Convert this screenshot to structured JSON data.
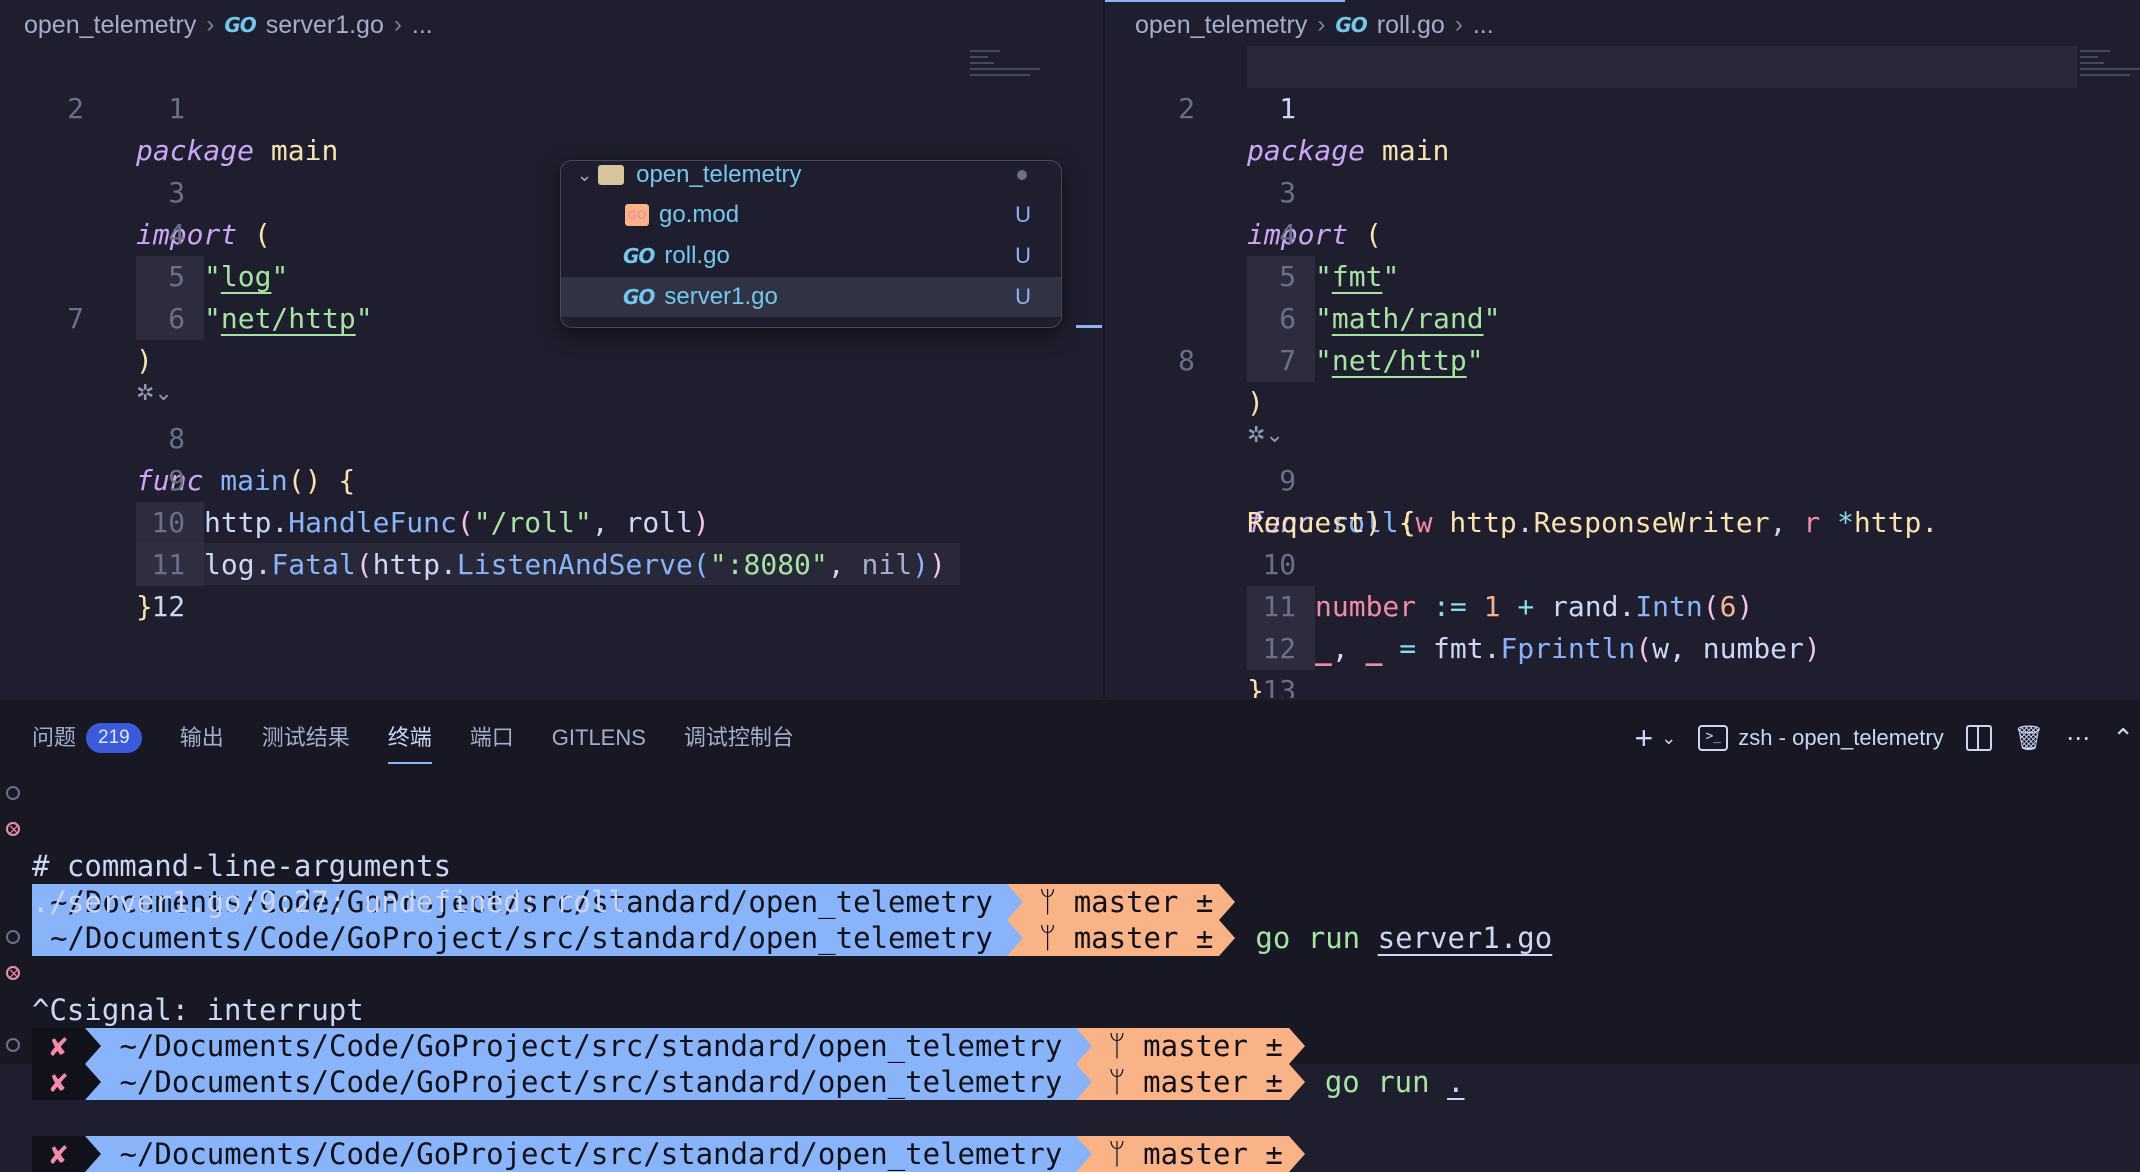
{
  "left_editor": {
    "breadcrumb": {
      "folder": "open_telemetry",
      "file": "server1.go",
      "more": "...",
      "go_icon": "GO"
    },
    "line_numbers": [
      "1",
      "2",
      "3",
      "4",
      "5",
      "6",
      "7",
      "8",
      "9",
      "10",
      "11",
      "12"
    ],
    "code": {
      "l1_kw": "package",
      "l1_name": "main",
      "l3_kw": "import",
      "l3_paren": "(",
      "l4_str": "log",
      "l5_str": "net/http",
      "l6_paren": ")",
      "l8_kw": "func",
      "l8_name": "main",
      "l8_paren": "()",
      "l8_brace": "{",
      "l9_pkg": "http",
      "l9_fn": "HandleFunc",
      "l9_str": "/roll",
      "l9_arg": "roll",
      "l10_pkg": "log",
      "l10_fn": "Fatal",
      "l10_pkg2": "http",
      "l10_fn2": "ListenAndServe",
      "l10_str": ":8080",
      "l10_nil": "nil",
      "l11_brace": "}"
    }
  },
  "right_editor": {
    "breadcrumb": {
      "folder": "open_telemetry",
      "file": "roll.go",
      "more": "...",
      "go_icon": "GO"
    },
    "line_numbers": [
      "1",
      "2",
      "3",
      "4",
      "5",
      "6",
      "7",
      "8",
      "9",
      "10",
      "11",
      "12",
      "13"
    ],
    "code": {
      "l1_kw": "package",
      "l1_name": "main",
      "l3_kw": "import",
      "l3_paren": "(",
      "l4_str": "fmt",
      "l5_str": "math/rand",
      "l6_str": "net/http",
      "l7_paren": ")",
      "l9_kw": "func",
      "l9_name": "roll",
      "l9_w": "w",
      "l9_type1_pkg": "http",
      "l9_type1": "ResponseWriter",
      "l9_r": "r",
      "l9_star": "*",
      "l9_type2_pkg": "http.",
      "l9b_type2": "Request",
      "l9b_paren": ")",
      "l9b_brace": "{",
      "l10_var": "number",
      "l10_op": ":=",
      "l10_num": "1",
      "l10_plus": "+",
      "l10_pkg": "rand",
      "l10_fn": "Intn",
      "l10_arg": "6",
      "l11_blank1": "_",
      "l11_blank2": "_",
      "l11_eq": "=",
      "l11_pkg": "fmt",
      "l11_fn": "Fprintln",
      "l11_a": "w",
      "l11_b": "number",
      "l12_brace": "}"
    }
  },
  "explorer_popup": {
    "folder": "open_telemetry",
    "files": [
      {
        "name": "go.mod",
        "badge": "U"
      },
      {
        "name": "roll.go",
        "badge": "U"
      },
      {
        "name": "server1.go",
        "badge": "U"
      }
    ]
  },
  "panel": {
    "tabs": [
      {
        "label": "问题",
        "count": "219"
      },
      {
        "label": "输出"
      },
      {
        "label": "测试结果"
      },
      {
        "label": "终端"
      },
      {
        "label": "端口"
      },
      {
        "label": "GITLENS"
      },
      {
        "label": "调试控制台"
      }
    ],
    "terminal_name": "zsh - open_telemetry"
  },
  "terminal": {
    "path": "~/Documents/Code/GoProject/src/standard/open_telemetry",
    "branch": "master ±",
    "branch_icon": "ᛘ",
    "err_mark": "✘",
    "cmd1_bin": "go run",
    "cmd1_arg": "server1.go",
    "out1": "# command-line-arguments",
    "out2": "./server1.go:9:27: undefined: roll",
    "cmd2_bin": "go run",
    "cmd2_arg": ".",
    "out3": "^Csignal: interrupt"
  }
}
